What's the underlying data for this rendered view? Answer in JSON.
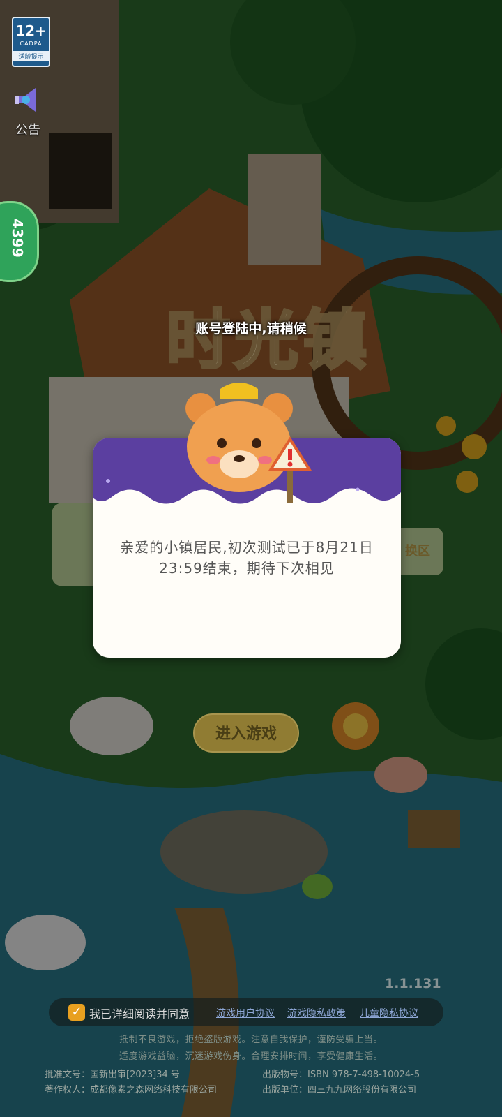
{
  "age_rating": {
    "label": "12+",
    "org": "CADPA",
    "tip": "适龄提示"
  },
  "announcement": {
    "label": "公告"
  },
  "side_tab": {
    "label": "4399"
  },
  "logo_text": "时光镇",
  "login_status": "账号登陆中,请稍候",
  "dialog": {
    "message": "亲爱的小镇居民,初次测试已于8月21日23:59结束，期待下次相见"
  },
  "enter_button": "进入游戏",
  "switch_server_label": "换区",
  "version": "1.1.131",
  "agreement": {
    "checked": true,
    "text": "我已详细阅读并同意",
    "links": [
      "游戏用户协议",
      "游戏隐私政策",
      "儿童隐私协议"
    ]
  },
  "health_notice": {
    "line1": "抵制不良游戏，拒绝盗版游戏。注意自我保护，谨防受骗上当。",
    "line2": "适度游戏益脑，沉迷游戏伤身。合理安排时间，享受健康生活。"
  },
  "footer": {
    "approval": "批准文号：国新出审[2023]34 号",
    "publication": "出版物号：ISBN 978-7-498-10024-5",
    "copyright": "著作权人：成都像素之森网络科技有限公司",
    "publisher": "出版单位：四三九九网络股份有限公司"
  },
  "colors": {
    "dialog_header": "#5b3fa0",
    "dialog_body": "#fffdf8",
    "checkbox": "#e8a020",
    "link": "#8fa8d8"
  }
}
